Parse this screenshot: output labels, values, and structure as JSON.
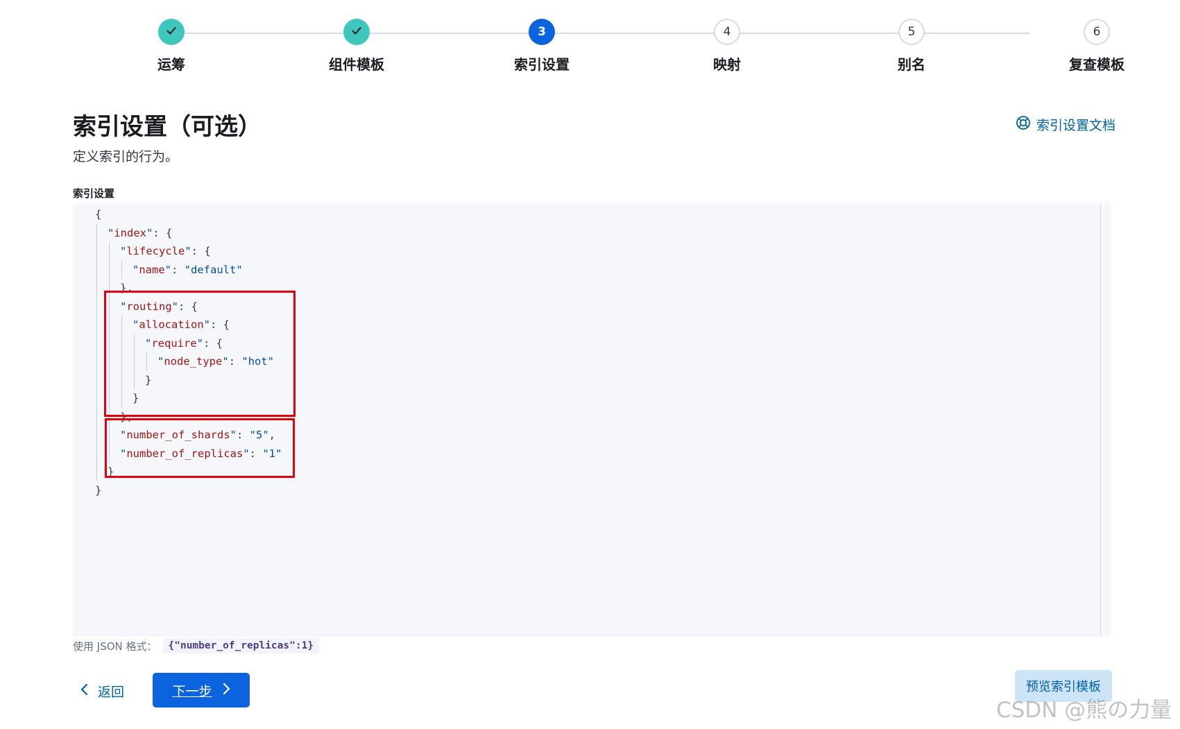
{
  "stepper": {
    "steps": [
      {
        "label": "运筹",
        "status": "complete",
        "number": "1"
      },
      {
        "label": "组件模板",
        "status": "complete",
        "number": "2"
      },
      {
        "label": "索引设置",
        "status": "current",
        "number": "3"
      },
      {
        "label": "映射",
        "status": "pending",
        "number": "4"
      },
      {
        "label": "别名",
        "status": "pending",
        "number": "5"
      },
      {
        "label": "复查模板",
        "status": "pending",
        "number": "6"
      }
    ]
  },
  "header": {
    "title": "索引设置（可选）",
    "subtitle": "定义索引的行为。",
    "docs_link": "索引设置文档"
  },
  "editor": {
    "label": "索引设置",
    "lines": [
      {
        "tokens": [
          [
            "p",
            "{"
          ]
        ]
      },
      {
        "tokens": [
          [
            "q",
            "\""
          ],
          [
            "k",
            "index"
          ],
          [
            "q",
            "\""
          ],
          [
            "p",
            ": {"
          ]
        ]
      },
      {
        "tokens": [
          [
            "q",
            "\""
          ],
          [
            "k",
            "lifecycle"
          ],
          [
            "q",
            "\""
          ],
          [
            "p",
            ": {"
          ]
        ]
      },
      {
        "tokens": [
          [
            "q",
            "\""
          ],
          [
            "k",
            "name"
          ],
          [
            "q",
            "\""
          ],
          [
            "p",
            ": "
          ],
          [
            "s",
            "\"default\""
          ]
        ]
      },
      {
        "tokens": [
          [
            "p",
            "},"
          ]
        ]
      },
      {
        "tokens": [
          [
            "q",
            "\""
          ],
          [
            "k",
            "routing"
          ],
          [
            "q",
            "\""
          ],
          [
            "p",
            ": {"
          ]
        ]
      },
      {
        "tokens": [
          [
            "q",
            "\""
          ],
          [
            "k",
            "allocation"
          ],
          [
            "q",
            "\""
          ],
          [
            "p",
            ": {"
          ]
        ]
      },
      {
        "tokens": [
          [
            "q",
            "\""
          ],
          [
            "k",
            "require"
          ],
          [
            "q",
            "\""
          ],
          [
            "p",
            ": {"
          ]
        ]
      },
      {
        "tokens": [
          [
            "q",
            "\""
          ],
          [
            "k",
            "node_type"
          ],
          [
            "q",
            "\""
          ],
          [
            "p",
            ": "
          ],
          [
            "s",
            "\"hot\""
          ]
        ]
      },
      {
        "tokens": [
          [
            "p",
            "}"
          ]
        ]
      },
      {
        "tokens": [
          [
            "p",
            "}"
          ]
        ]
      },
      {
        "tokens": [
          [
            "p",
            "},"
          ]
        ]
      },
      {
        "tokens": [
          [
            "q",
            "\""
          ],
          [
            "k",
            "number_of_shards"
          ],
          [
            "q",
            "\""
          ],
          [
            "p",
            ": "
          ],
          [
            "s",
            "\"5\""
          ],
          [
            "p",
            ","
          ]
        ]
      },
      {
        "tokens": [
          [
            "q",
            "\""
          ],
          [
            "k",
            "number_of_replicas"
          ],
          [
            "q",
            "\""
          ],
          [
            "p",
            ": "
          ],
          [
            "s",
            "\"1\""
          ]
        ]
      },
      {
        "tokens": [
          [
            "p",
            "}"
          ]
        ]
      },
      {
        "tokens": [
          [
            "p",
            "}"
          ]
        ]
      }
    ]
  },
  "help": {
    "prefix": "使用 JSON 格式：",
    "example": "{\"number_of_replicas\":1}"
  },
  "footer": {
    "back_label": "返回",
    "next_label": "下一步",
    "preview_label": "预览索引模板"
  },
  "watermark": "CSDN @熊の力量",
  "colors": {
    "primary": "#0b64dd",
    "complete": "#3ec7bd",
    "highlight": "#e3000f",
    "link": "#0061a6"
  }
}
